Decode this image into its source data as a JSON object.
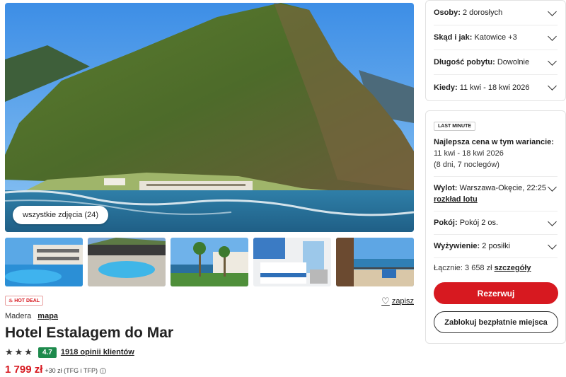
{
  "gallery": {
    "all_photos_label": "wszystkie zdjęcia (24)",
    "main_photo_icon": "landscape-image",
    "thumbnails": [
      "pool-image",
      "pool-round-image",
      "palms-image",
      "bedroom-image",
      "balcony-image"
    ]
  },
  "hotel": {
    "badge": "HOT DEAL",
    "save_label": "zapisz",
    "region": "Madera",
    "map_label": "mapa",
    "name": "Hotel Estalagem do Mar",
    "stars": "★★★",
    "score": "4.7",
    "reviews_label": "1918 opinii klientów",
    "price": "1 799 zł",
    "price_extra": "+30 zł (TFG i TFP)",
    "info_icon": "ⓘ"
  },
  "filters": [
    {
      "label": "Osoby:",
      "value": "2 dorosłych"
    },
    {
      "label": "Skąd i jak:",
      "value": "Katowice +3"
    },
    {
      "label": "Długość pobytu:",
      "value": "Dowolnie"
    },
    {
      "label": "Kiedy:",
      "value": "11 kwi - 18 kwi 2026"
    }
  ],
  "offer": {
    "badge": "LAST MINUTE",
    "best_price_label": "Najlepsza cena w tym wariancie:",
    "dates": "11 kwi - 18 kwi 2026",
    "duration": "(8 dni, 7 noclegów)",
    "departure_label": "Wylot:",
    "departure_value": "Warszawa-Okęcie, 22:25",
    "schedule_label": "rozkład lotu",
    "room_label": "Pokój:",
    "room_value": "Pokój 2 os.",
    "board_label": "Wyżywienie:",
    "board_value": "2 posiłki",
    "total_label": "Łącznie: 3 658 zł",
    "details_label": "szczegóły",
    "reserve_label": "Rezerwuj",
    "block_label": "Zablokuj bezpłatnie miejsca"
  },
  "colors": {
    "accent": "#d71920",
    "score_bg": "#1d8a4c"
  }
}
